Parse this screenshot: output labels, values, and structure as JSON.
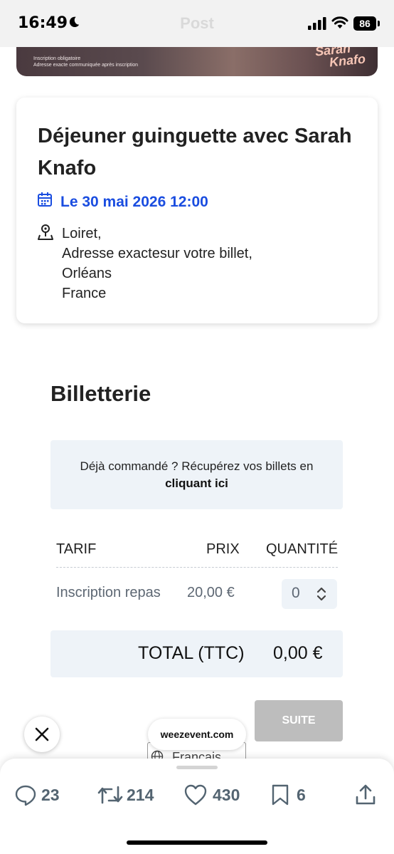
{
  "status_bar": {
    "time": "16:49",
    "battery": "86",
    "nav_title": "Post"
  },
  "banner": {
    "line1": "Inscription obligatoire",
    "line2": "Adresse exacte communiquée après inscription",
    "logo_line1": "Sarah",
    "logo_line2": "Knafo"
  },
  "event": {
    "title": "Déjeuner guinguette avec Sarah Knafo",
    "date": "Le 30 mai 2026 12:00",
    "location_lines": [
      "Loiret,",
      "Adresse exactesur votre billet,",
      "Orléans",
      "France"
    ]
  },
  "ticketing": {
    "heading": "Billetterie",
    "already_ordered": "Déjà commandé ? Récupérez vos billets en",
    "already_link": "cliquant ici",
    "columns": [
      "TARIF",
      "PRIX",
      "QUANTITÉ"
    ],
    "rows": [
      {
        "tarif": "Inscription repas",
        "prix": "20,00 €",
        "quantite": "0"
      }
    ],
    "total_label": "TOTAL (TTC)",
    "total_value": "0,00 €",
    "next_button": "SUITE"
  },
  "webview": {
    "domain": "weezevent.com",
    "language": "Français"
  },
  "actions": {
    "replies": "23",
    "reposts": "214",
    "likes": "430",
    "bookmarks": "6"
  },
  "colors": {
    "accent_blue": "#1a4de0",
    "panel_bg": "#eef3f8",
    "disabled_button": "#bdbdbd",
    "action_gray": "#536471"
  }
}
